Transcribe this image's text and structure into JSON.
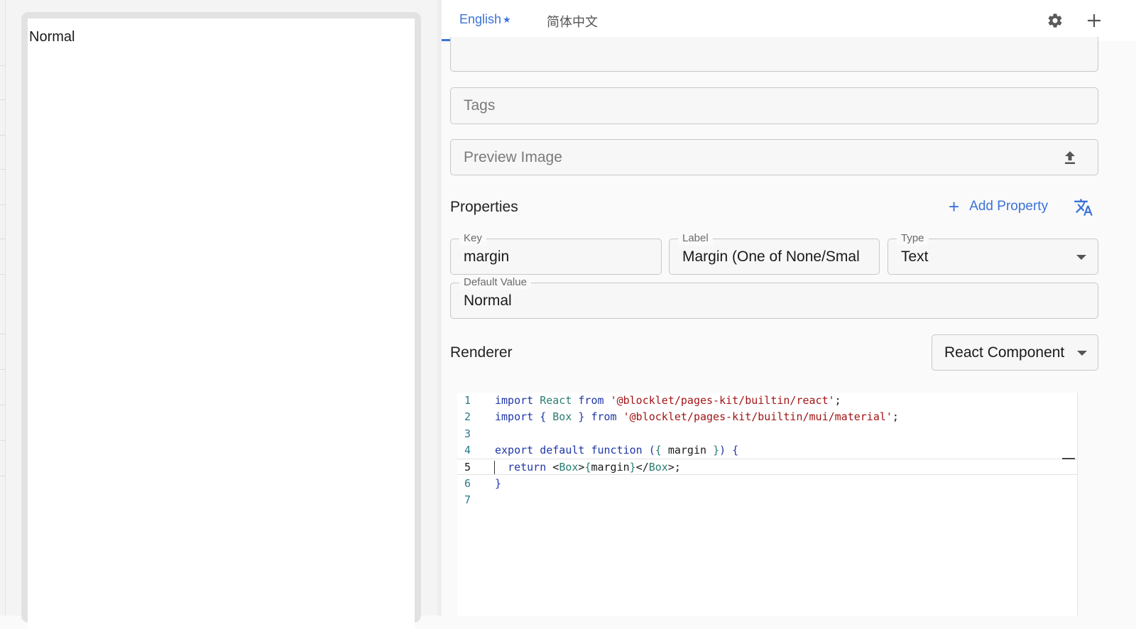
{
  "preview": {
    "text": "Normal"
  },
  "tabs": [
    {
      "label": "English",
      "marker": "★",
      "active": true
    },
    {
      "label": "简体中文",
      "active": false
    }
  ],
  "toolbar": {
    "settings_icon": "gear-icon",
    "add_icon": "plus-icon"
  },
  "form": {
    "tags_placeholder": "Tags",
    "preview_image_placeholder": "Preview Image",
    "upload_icon": "upload-icon"
  },
  "properties": {
    "title": "Properties",
    "add_label": "Add Property",
    "translate_icon": "translate-icon",
    "key": {
      "label": "Key",
      "value": "margin"
    },
    "label": {
      "label": "Label",
      "value": "Margin (One of None/Smal"
    },
    "type": {
      "label": "Type",
      "value": "Text"
    },
    "default_value": {
      "label": "Default Value",
      "value": "Normal"
    }
  },
  "renderer": {
    "title": "Renderer",
    "selected": "React Component"
  },
  "editor": {
    "line_numbers": [
      "1",
      "2",
      "3",
      "4",
      "5",
      "6",
      "7"
    ],
    "active_line": 5,
    "lines": [
      [
        [
          "kw",
          "import "
        ],
        [
          "id",
          "React "
        ],
        [
          "kw",
          "from "
        ],
        [
          "str",
          "'@blocklet/pages-kit/builtin/react'"
        ],
        [
          "plain",
          ";"
        ]
      ],
      [
        [
          "kw",
          "import "
        ],
        [
          "kw",
          "{ "
        ],
        [
          "id",
          "Box "
        ],
        [
          "kw",
          "} "
        ],
        [
          "kw",
          "from "
        ],
        [
          "str",
          "'@blocklet/pages-kit/builtin/mui/material'"
        ],
        [
          "plain",
          ";"
        ]
      ],
      [],
      [
        [
          "kw",
          "export default function "
        ],
        [
          "kw",
          "("
        ],
        [
          "br",
          "{ "
        ],
        [
          "plain",
          "margin "
        ],
        [
          "br",
          "}"
        ],
        [
          "kw",
          ") {"
        ]
      ],
      [
        [
          "plain",
          "  "
        ],
        [
          "kw",
          "return "
        ],
        [
          "plain",
          "<"
        ],
        [
          "id",
          "Box"
        ],
        [
          "plain",
          ">"
        ],
        [
          "br",
          "{"
        ],
        [
          "plain",
          "margin"
        ],
        [
          "br",
          "}"
        ],
        [
          "plain",
          "</"
        ],
        [
          "id",
          "Box"
        ],
        [
          "plain",
          ">;"
        ]
      ],
      [
        [
          "kw",
          "}"
        ]
      ],
      []
    ]
  },
  "colors": {
    "accent": "#3b72d9",
    "keyword": "#1f37a8",
    "string": "#a31515",
    "identifier": "#2a7d73"
  }
}
